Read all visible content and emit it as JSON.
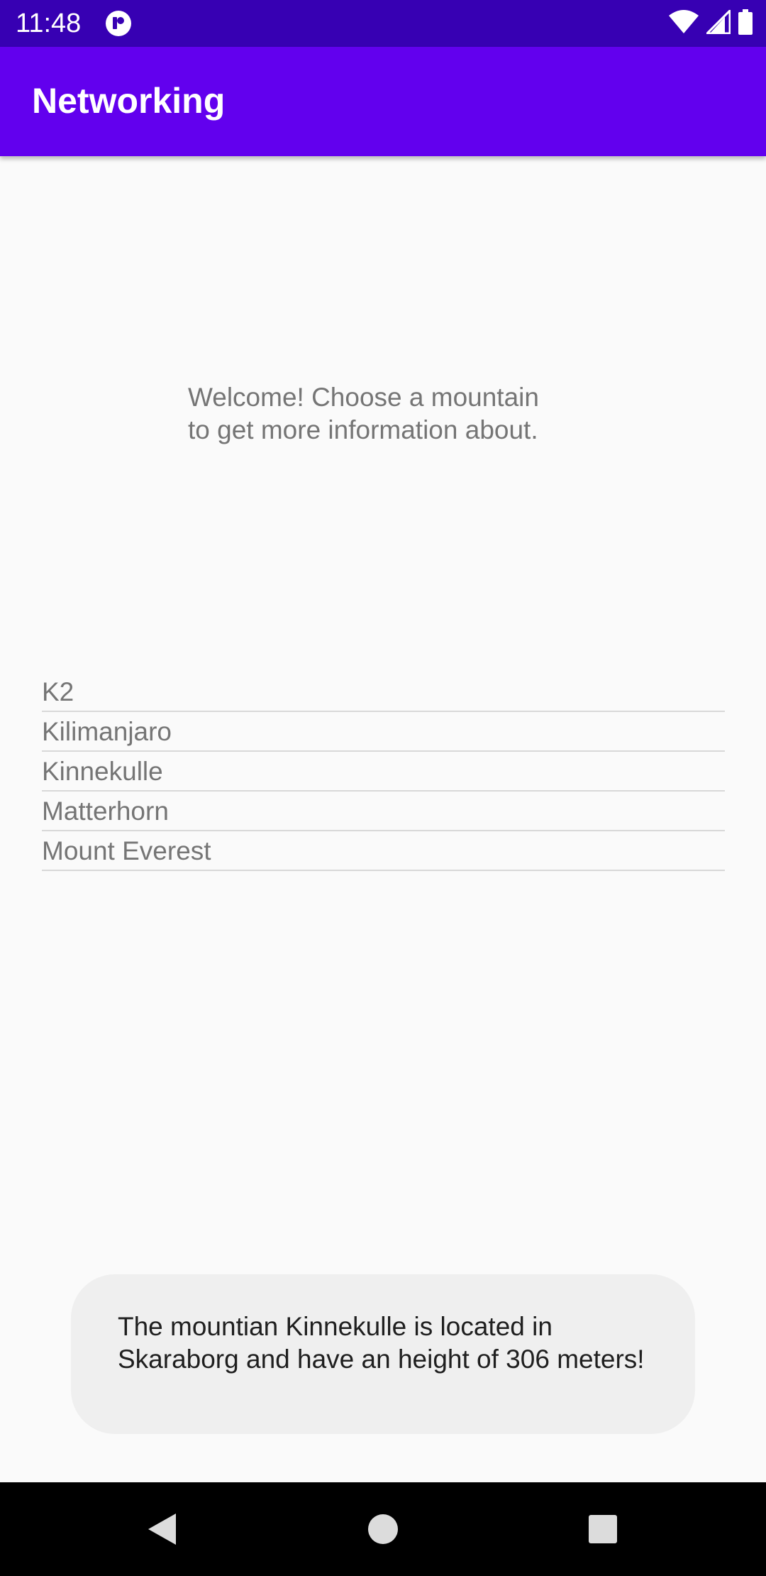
{
  "status_bar": {
    "time": "11:48",
    "icons": [
      "app-notification-icon",
      "wifi-icon",
      "cell-signal-icon",
      "battery-icon"
    ]
  },
  "app_bar": {
    "title": "Networking"
  },
  "welcome": {
    "line1": "Welcome! Choose a mountain",
    "line2": "to get more information about."
  },
  "mountains": [
    "K2",
    "Kilimanjaro",
    "Kinnekulle",
    "Matterhorn",
    "Mount Everest"
  ],
  "toast": {
    "message": "The mountian Kinnekulle is located in Skaraborg and have an height of 306 meters!"
  },
  "nav_bar": {
    "buttons": [
      "back-icon",
      "home-icon",
      "recents-icon"
    ]
  },
  "colors": {
    "status_bar": "#3700b3",
    "app_bar": "#6200ee",
    "background": "#fafafa",
    "toast_background": "#efefef"
  }
}
